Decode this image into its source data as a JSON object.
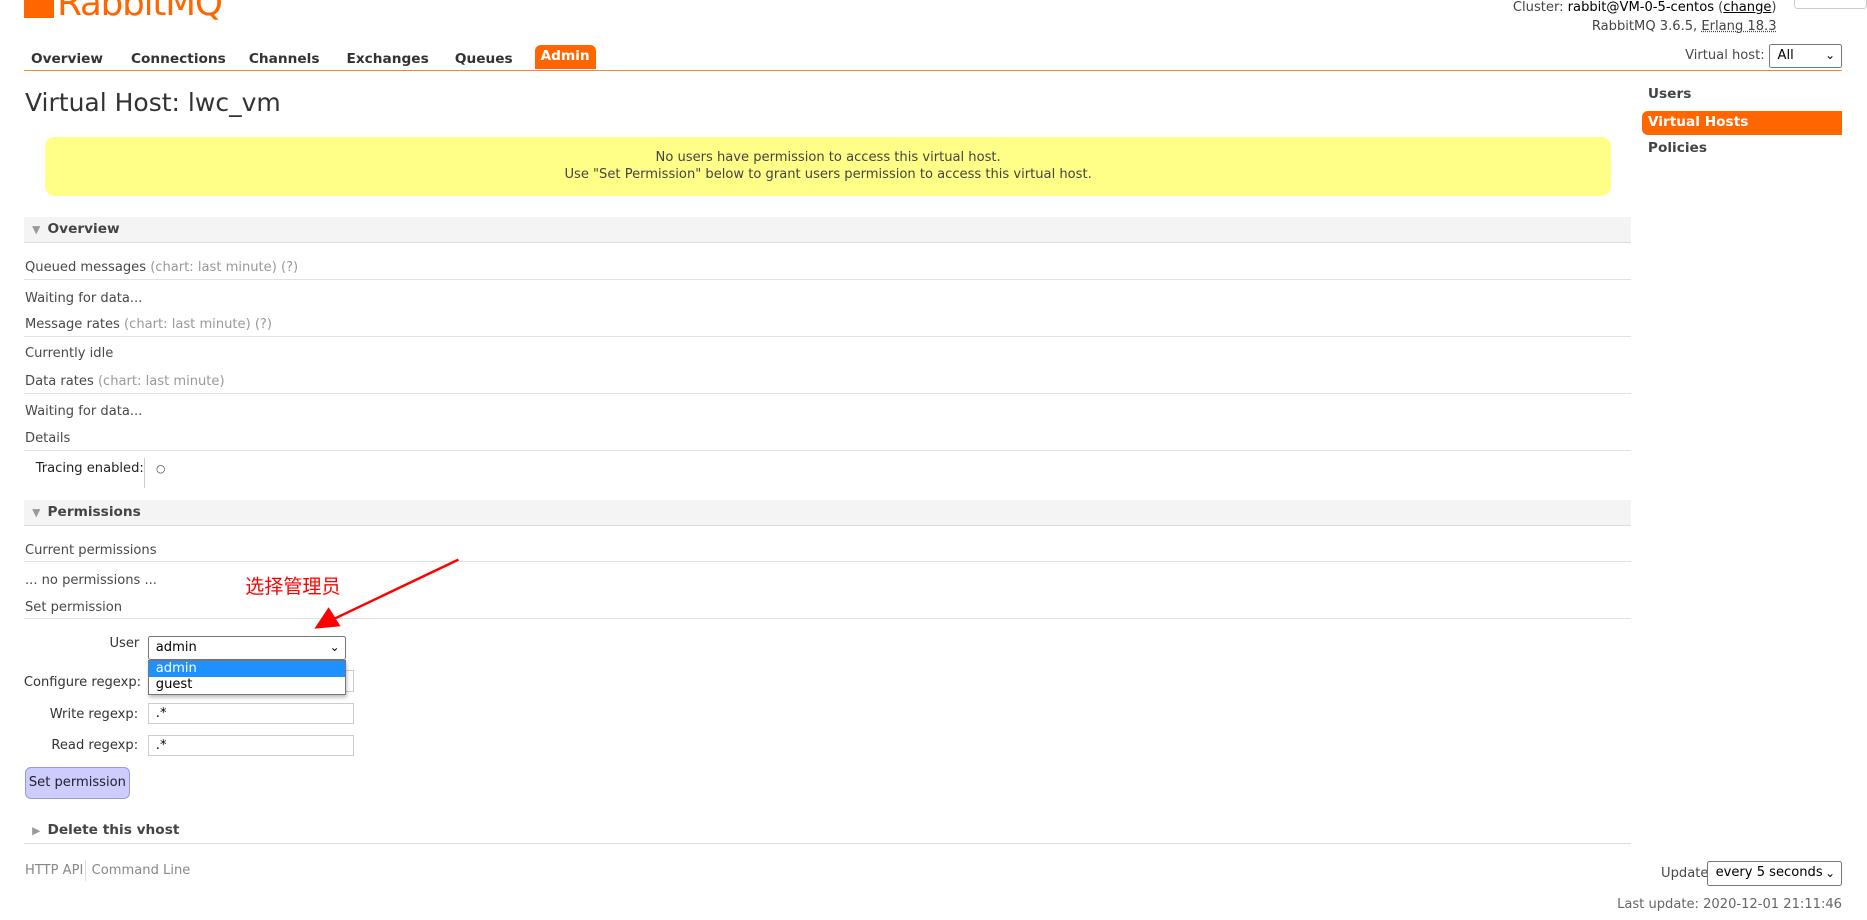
{
  "header": {
    "logo_text": "RabbitMQ",
    "cluster_label": "Cluster: ",
    "cluster_name": "rabbit@VM-0-5-centos",
    "cluster_change": "change",
    "version": "RabbitMQ 3.6.5, ",
    "erlang": "Erlang 18.3",
    "vhost_label": "Virtual host:",
    "vhost_value": "All"
  },
  "nav": {
    "tabs": [
      {
        "label": "Overview"
      },
      {
        "label": "Connections"
      },
      {
        "label": "Channels"
      },
      {
        "label": "Exchanges"
      },
      {
        "label": "Queues"
      },
      {
        "label": "Admin",
        "active": true
      }
    ]
  },
  "page_title": "Virtual Host: lwc_vm",
  "sidebar": {
    "items": [
      {
        "label": "Users"
      },
      {
        "label": "Virtual Hosts",
        "active": true
      },
      {
        "label": "Policies"
      }
    ]
  },
  "notice": {
    "line1": "No users have permission to access this virtual host.",
    "line2": "Use \"Set Permission\" below to grant users permission to access this virtual host."
  },
  "overview": {
    "title": "Overview",
    "queued": "Queued messages",
    "queued_note": "(chart: last minute) (?)",
    "queued_status": "Waiting for data...",
    "rates": "Message rates",
    "rates_note": "(chart: last minute) (?)",
    "rates_status": "Currently idle",
    "data": "Data rates",
    "data_note": "(chart: last minute)",
    "data_status": "Waiting for data...",
    "details": "Details",
    "tracing_label": "Tracing enabled:",
    "tracing_value": "○"
  },
  "permissions": {
    "title": "Permissions",
    "current": "Current permissions",
    "none": "... no permissions ...",
    "set": "Set permission",
    "user_label": "User",
    "user_value": "admin",
    "user_options": [
      "admin",
      "guest"
    ],
    "configure_label": "Configure regexp:",
    "configure_value": ".*",
    "write_label": "Write regexp:",
    "write_value": ".*",
    "read_label": "Read regexp:",
    "read_value": ".*",
    "button": "Set permission"
  },
  "delete_section": "Delete this vhost",
  "footer": {
    "http_api": "HTTP API",
    "command_line": "Command Line",
    "update_label": "Update",
    "update_value": "every 5 seconds",
    "last_update": "Last update: 2020-12-01 21:11:46"
  },
  "annotation": {
    "text": "选择管理员",
    "color": "#ff0000"
  },
  "colors": {
    "accent": "#ff6600",
    "notice_bg": "#ffff88",
    "button_bg": "#ccccff",
    "selected_option": "#1e90ff"
  }
}
